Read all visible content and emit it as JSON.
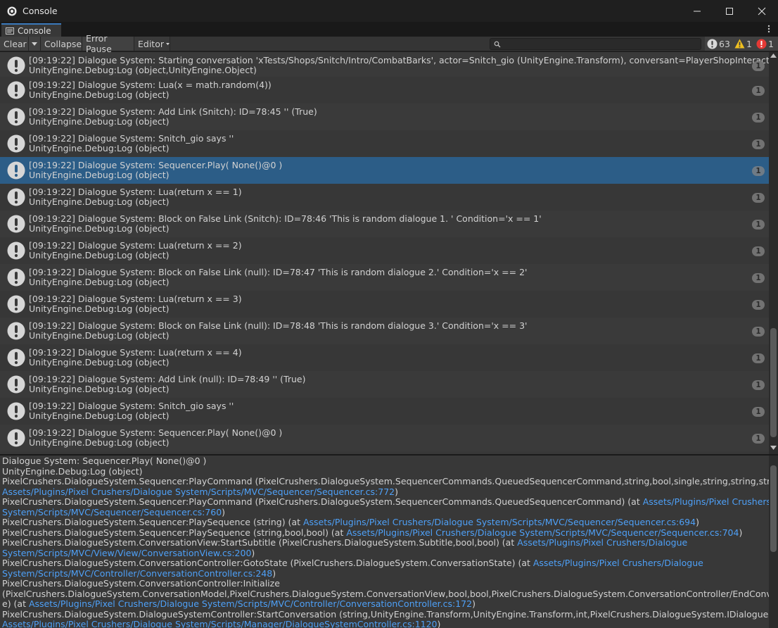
{
  "window": {
    "title": "Console"
  },
  "tab": {
    "label": "Console"
  },
  "toolbar": {
    "clear_label": "Clear",
    "collapse_label": "Collapse",
    "error_pause_label": "Error Pause",
    "editor_label": "Editor",
    "search_placeholder": "",
    "log_count": "63",
    "warning_count": "1",
    "error_count": "1"
  },
  "colors": {
    "accent": "#3a79bb",
    "selected_row": "#2c5d87",
    "link": "#4ea0f7",
    "warning": "#f0c020",
    "error": "#e53935"
  },
  "logs": [
    {
      "line1": "[09:19:22] Dialogue System: Starting conversation 'xTests/Shops/Snitch/Intro/CombatBarks', actor=Snitch_gio (UnityEngine.Transform), conversant=PlayerShopInteract (UnityEngine.Tran",
      "line2": "UnityEngine.Debug:Log (object,UnityEngine.Object)",
      "count": "1"
    },
    {
      "line1": "[09:19:22] Dialogue System: Lua(x = math.random(4))",
      "line2": "UnityEngine.Debug:Log (object)",
      "count": "1"
    },
    {
      "line1": "[09:19:22] Dialogue System: Add Link (Snitch): ID=78:45 '' (True)",
      "line2": "UnityEngine.Debug:Log (object)",
      "count": "1"
    },
    {
      "line1": "[09:19:22] Dialogue System: Snitch_gio says ''",
      "line2": "UnityEngine.Debug:Log (object)",
      "count": "1"
    },
    {
      "line1": "[09:19:22] Dialogue System: Sequencer.Play( None()@0 )",
      "line2": "UnityEngine.Debug:Log (object)",
      "count": "1"
    },
    {
      "line1": "[09:19:22] Dialogue System: Lua(return x == 1)",
      "line2": "UnityEngine.Debug:Log (object)",
      "count": "1"
    },
    {
      "line1": "[09:19:22] Dialogue System: Block on False Link (Snitch): ID=78:46 'This is random dialogue 1. ' Condition='x == 1'",
      "line2": "UnityEngine.Debug:Log (object)",
      "count": "1"
    },
    {
      "line1": "[09:19:22] Dialogue System: Lua(return x == 2)",
      "line2": "UnityEngine.Debug:Log (object)",
      "count": "1"
    },
    {
      "line1": "[09:19:22] Dialogue System: Block on False Link (null): ID=78:47 'This is random dialogue 2.' Condition='x == 2'",
      "line2": "UnityEngine.Debug:Log (object)",
      "count": "1"
    },
    {
      "line1": "[09:19:22] Dialogue System: Lua(return x == 3)",
      "line2": "UnityEngine.Debug:Log (object)",
      "count": "1"
    },
    {
      "line1": "[09:19:22] Dialogue System: Block on False Link (null): ID=78:48 'This is random dialogue 3.' Condition='x == 3'",
      "line2": "UnityEngine.Debug:Log (object)",
      "count": "1"
    },
    {
      "line1": "[09:19:22] Dialogue System: Lua(return x == 4)",
      "line2": "UnityEngine.Debug:Log (object)",
      "count": "1"
    },
    {
      "line1": "[09:19:22] Dialogue System: Add Link (null): ID=78:49 '' (True)",
      "line2": "UnityEngine.Debug:Log (object)",
      "count": "1"
    },
    {
      "line1": "[09:19:22] Dialogue System: Snitch_gio says ''",
      "line2": "UnityEngine.Debug:Log (object)",
      "count": "1"
    },
    {
      "line1": "[09:19:22] Dialogue System: Sequencer.Play( None()@0 )",
      "line2": "UnityEngine.Debug:Log (object)",
      "count": "1"
    }
  ],
  "selected_index": 4,
  "detail": [
    {
      "text": "Dialogue System: Sequencer.Play( None()@0 )",
      "link": "",
      "after": ""
    },
    {
      "text": "UnityEngine.Debug:Log (object)",
      "link": "",
      "after": ""
    },
    {
      "text": "PixelCrushers.DialogueSystem.Sequencer:PlayCommand (PixelCrushers.DialogueSystem.SequencerCommands.QueuedSequencerCommand,string,bool,single,string,string,string[]) (at",
      "link": "",
      "after": ""
    },
    {
      "text": "",
      "link": "Assets/Plugins/Pixel Crushers/Dialogue System/Scripts/MVC/Sequencer/Sequencer.cs:772",
      "after": ")"
    },
    {
      "text": "PixelCrushers.DialogueSystem.Sequencer:PlayCommand (PixelCrushers.DialogueSystem.SequencerCommands.QueuedSequencerCommand) (at ",
      "link": "Assets/Plugins/Pixel Crushers/Dialogue",
      "after": ""
    },
    {
      "text": "",
      "link": "System/Scripts/MVC/Sequencer/Sequencer.cs:760",
      "after": ")"
    },
    {
      "text": "PixelCrushers.DialogueSystem.Sequencer:PlaySequence (string) (at ",
      "link": "Assets/Plugins/Pixel Crushers/Dialogue System/Scripts/MVC/Sequencer/Sequencer.cs:694",
      "after": ")"
    },
    {
      "text": "PixelCrushers.DialogueSystem.Sequencer:PlaySequence (string,bool,bool) (at ",
      "link": "Assets/Plugins/Pixel Crushers/Dialogue System/Scripts/MVC/Sequencer/Sequencer.cs:704",
      "after": ")"
    },
    {
      "text": "PixelCrushers.DialogueSystem.ConversationView:StartSubtitle (PixelCrushers.DialogueSystem.Subtitle,bool,bool) (at ",
      "link": "Assets/Plugins/Pixel Crushers/Dialogue",
      "after": ""
    },
    {
      "text": "",
      "link": "System/Scripts/MVC/View/View/ConversationView.cs:200",
      "after": ")"
    },
    {
      "text": "PixelCrushers.DialogueSystem.ConversationController:GotoState (PixelCrushers.DialogueSystem.ConversationState) (at ",
      "link": "Assets/Plugins/Pixel Crushers/Dialogue",
      "after": ""
    },
    {
      "text": "",
      "link": "System/Scripts/MVC/Controller/ConversationController.cs:248",
      "after": ")"
    },
    {
      "text": "PixelCrushers.DialogueSystem.ConversationController:Initialize",
      "link": "",
      "after": ""
    },
    {
      "text": "(PixelCrushers.DialogueSystem.ConversationModel,PixelCrushers.DialogueSystem.ConversationView,bool,bool,PixelCrushers.DialogueSystem.ConversationController/EndConversationDelegat",
      "link": "",
      "after": ""
    },
    {
      "text": "e) (at ",
      "link": "Assets/Plugins/Pixel Crushers/Dialogue System/Scripts/MVC/Controller/ConversationController.cs:172",
      "after": ")"
    },
    {
      "text": "PixelCrushers.DialogueSystem.DialogueSystemController:StartConversation (string,UnityEngine.Transform,UnityEngine.Transform,int,PixelCrushers.DialogueSystem.IDialogueUI) (at",
      "link": "",
      "after": ""
    },
    {
      "text": "",
      "link": "Assets/Plugins/Pixel Crushers/Dialogue System/Scripts/Manager/DialogueSystemController.cs:1120",
      "after": ")"
    }
  ]
}
